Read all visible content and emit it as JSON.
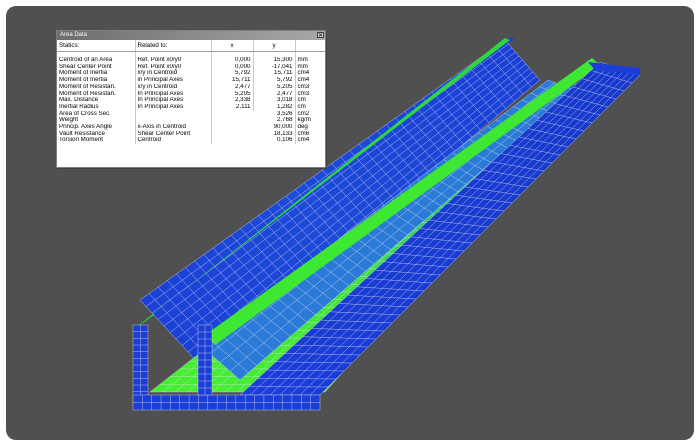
{
  "app": {
    "window_title": "Area Data",
    "close_glyph": "✕"
  },
  "colors": {
    "background": "#505050",
    "frame": "#ffffff",
    "mesh_blue": "#1a3ed6",
    "mesh_green": "#3ee832",
    "mesh_lines": "#dcdcf0",
    "titlebar": "#7d7d7d"
  },
  "table": {
    "headers": [
      "Statics:",
      "Related to:",
      "x",
      "y",
      ""
    ],
    "rows": [
      {
        "name": "Centroid of an Area",
        "related": "Ref. Point x0/y0",
        "x": "0,000",
        "y": "15,300",
        "unit": "mm"
      },
      {
        "name": "Shear Center Point",
        "related": "Ref. Point x0/y0",
        "x": "0,000",
        "y": "-17,041",
        "unit": "mm"
      },
      {
        "name": "Moment of Inertia",
        "related": "x/y in Centroid",
        "x": "5,792",
        "y": "15,711",
        "unit": "cm4"
      },
      {
        "name": "Moment of Inertia",
        "related": "in Principal Axes",
        "x": "15,711",
        "y": "5,792",
        "unit": "cm4"
      },
      {
        "name": "Moment of Resistan.",
        "related": "x/y in Centroid",
        "x": "2,477",
        "y": "5,205",
        "unit": "cm3"
      },
      {
        "name": "Moment of Resistan.",
        "related": "In Principal Axes",
        "x": "5,205",
        "y": "2,477",
        "unit": "cm3"
      },
      {
        "name": "Max. Distance",
        "related": "In Principal Axes",
        "x": "2,338",
        "y": "3,018",
        "unit": "cm"
      },
      {
        "name": "Inertial Radius",
        "related": "In Principal Axes",
        "x": "2,111",
        "y": "1,282",
        "unit": "cm"
      }
    ],
    "single_rows": [
      {
        "name": "Area of Cross Sec.",
        "related": "",
        "value": "3,526",
        "unit": "cm2"
      },
      {
        "name": "Weight",
        "related": "",
        "value": "2,768",
        "unit": "kg/m"
      },
      {
        "name": "Princip. Axes Angle",
        "related": "x-Axis in Centroid",
        "value": "90,000",
        "unit": "deg"
      },
      {
        "name": "Vault Resistance",
        "related": "Shear Center Point",
        "value": "18,133",
        "unit": "cm6"
      },
      {
        "name": "Torsion Moment",
        "related": "Centroid",
        "value": "0,106",
        "unit": "cm4"
      }
    ]
  }
}
